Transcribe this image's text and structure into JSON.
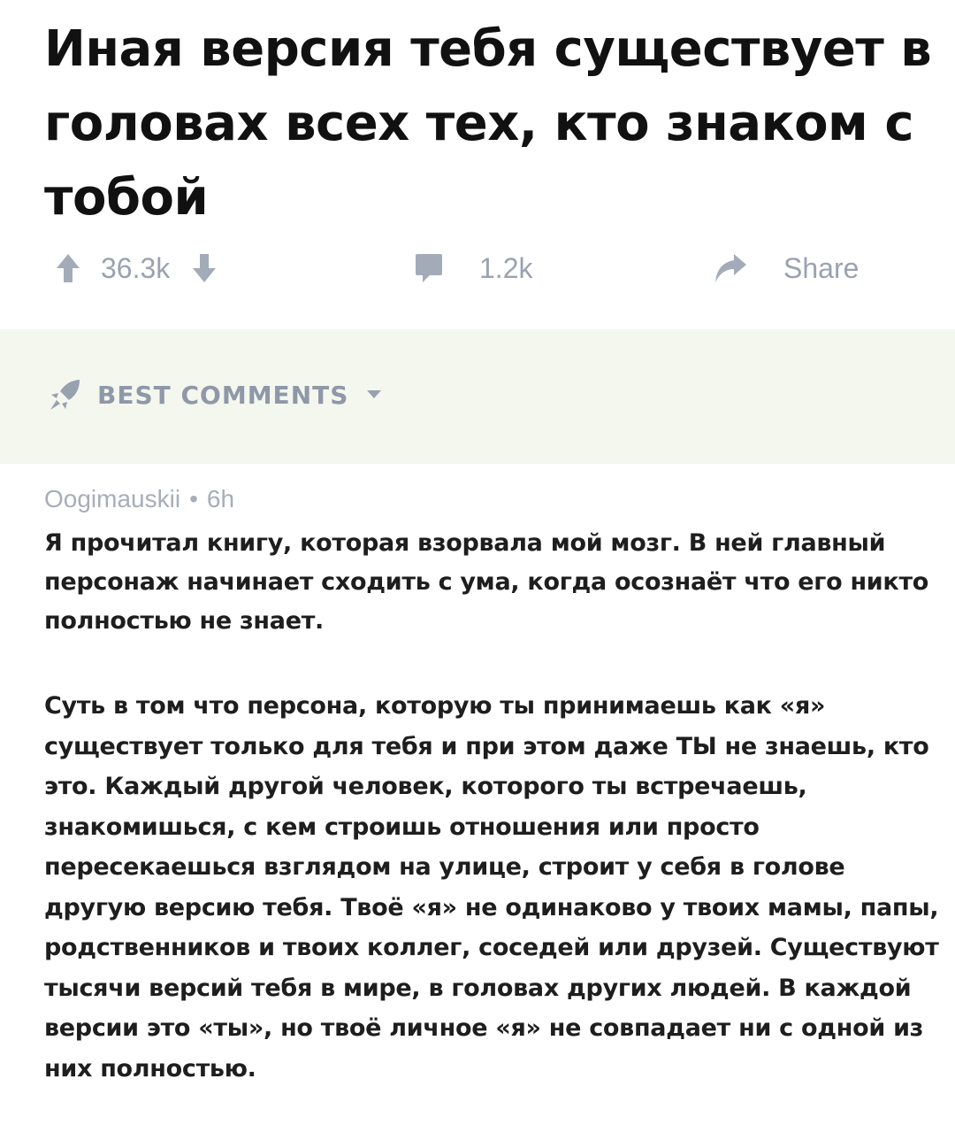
{
  "post": {
    "title": "Иная версия тебя существует в головах всех тех, кто знаком с тобой",
    "upvotes": "36.3k",
    "comments_count": "1.2k",
    "share_label": "Share"
  },
  "sort": {
    "label": "BEST COMMENTS"
  },
  "comment": {
    "author": "Oogimauskii",
    "separator": "•",
    "age": "6h",
    "paragraphs": [
      "Я прочитал книгу, которая взорвала мой мозг. В ней главный персонаж начинает сходить с ума, когда осознаёт что его никто полностью не знает.",
      "Суть в том что персона, которую ты принимаешь как «я» существует только для тебя и при этом даже ТЫ не знаешь, кто это. Каждый другой человек, которого ты встречаешь, знакомишься, с кем строишь отношения или просто пересекаешься взглядом на улице, строит у себя в голове другую версию тебя. Твоё «я» не одинаково у твоих мамы, папы, родственников и твоих коллег, соседей или друзей. Существуют тысячи версий тебя в мире, в головах других людей. В каждой версии это «ты», но твоё личное «я» не совпадает ни с одной из них полностью."
    ]
  },
  "colors": {
    "muted": "#9aa2b1",
    "best_bar_bg": "#f3f7ee",
    "text": "#1e1e1e"
  },
  "icons": {
    "upvote": "arrow-up-icon",
    "downvote": "arrow-down-icon",
    "comment": "comment-bubble-icon",
    "share": "share-arrow-icon",
    "sort": "rocket-icon",
    "dropdown": "chevron-down-icon"
  }
}
